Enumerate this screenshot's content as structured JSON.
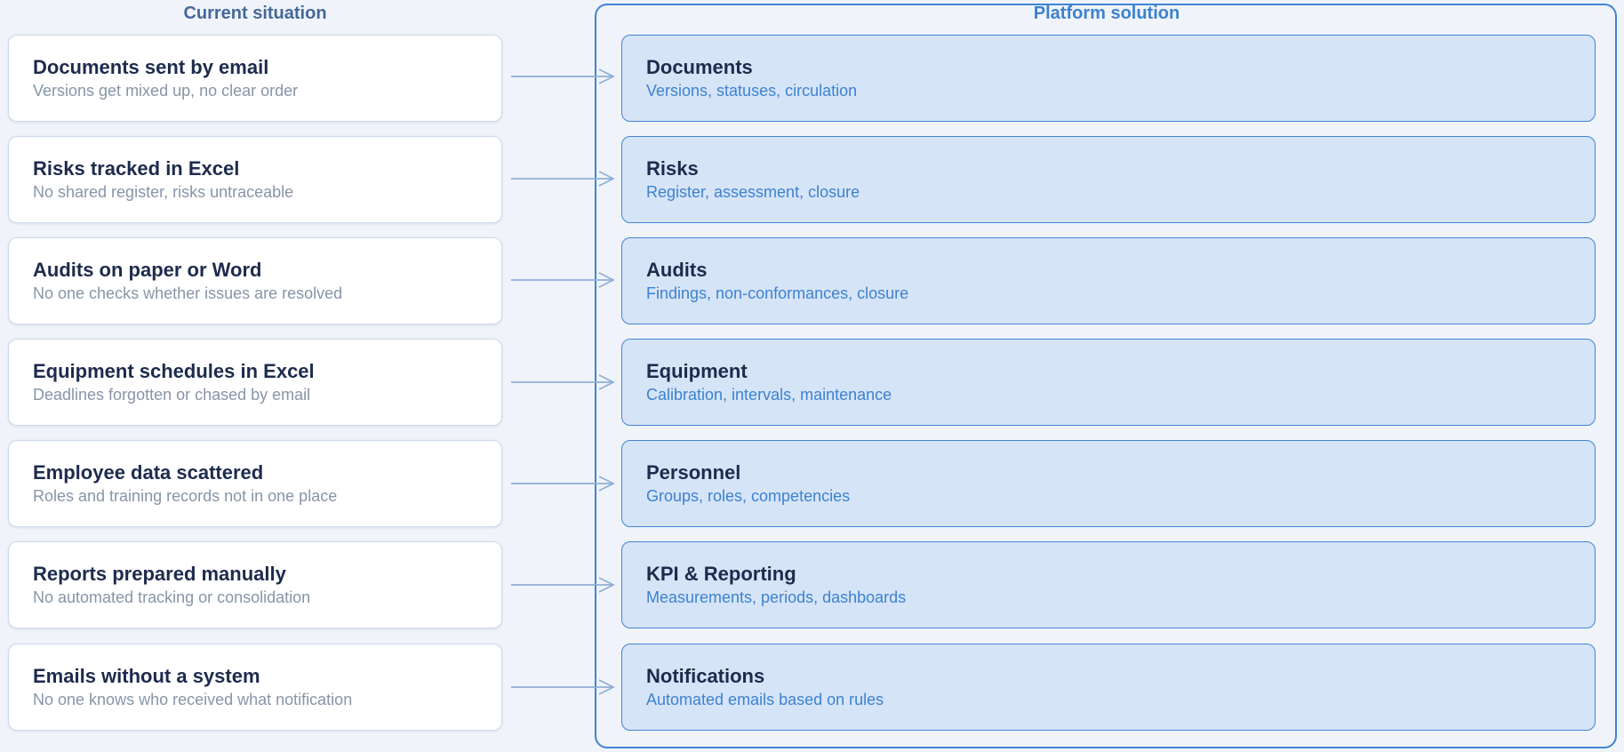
{
  "headers": {
    "current": "Current situation",
    "platform": "Platform solution"
  },
  "rows": [
    {
      "current_title": "Documents sent by email",
      "current_sub": "Versions get mixed up, no clear order",
      "solution_title": "Documents",
      "solution_sub": "Versions, statuses, circulation"
    },
    {
      "current_title": "Risks tracked in Excel",
      "current_sub": "No shared register, risks untraceable",
      "solution_title": "Risks",
      "solution_sub": "Register, assessment, closure"
    },
    {
      "current_title": "Audits on paper or Word",
      "current_sub": "No one checks whether issues are resolved",
      "solution_title": "Audits",
      "solution_sub": "Findings, non-conformances, closure"
    },
    {
      "current_title": "Equipment schedules in Excel",
      "current_sub": "Deadlines forgotten or chased by email",
      "solution_title": "Equipment",
      "solution_sub": "Calibration, intervals, maintenance"
    },
    {
      "current_title": "Employee data scattered",
      "current_sub": "Roles and training records not in one place",
      "solution_title": "Personnel",
      "solution_sub": "Groups, roles, competencies"
    },
    {
      "current_title": "Reports prepared manually",
      "current_sub": "No automated tracking or consolidation",
      "solution_title": "KPI & Reporting",
      "solution_sub": "Measurements, periods, dashboards"
    },
    {
      "current_title": "Emails without a system",
      "current_sub": "No one knows who received what notification",
      "solution_title": "Notifications",
      "solution_sub": "Automated emails based on rules"
    }
  ],
  "colors": {
    "background": "#f0f4fa",
    "accent": "#3f84d3",
    "solution_fill": "#d6e4f7",
    "arrow": "#8fb0d8",
    "title_text": "#1d2b4d"
  }
}
